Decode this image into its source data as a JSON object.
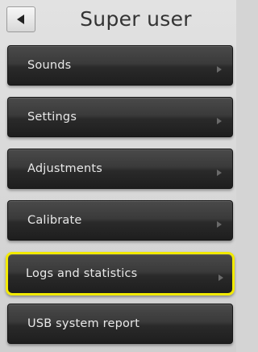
{
  "header": {
    "title": "Super user",
    "back_icon": "back-triangle-icon"
  },
  "menu": {
    "items": [
      {
        "label": "Sounds",
        "has_arrow": true
      },
      {
        "label": "Settings",
        "has_arrow": true
      },
      {
        "label": "Adjustments",
        "has_arrow": true
      },
      {
        "label": "Calibrate",
        "has_arrow": true
      },
      {
        "label": "Logs and statistics",
        "has_arrow": true,
        "highlighted": true
      },
      {
        "label": "USB system report",
        "has_arrow": false
      }
    ]
  },
  "colors": {
    "background": "#d4d4d4",
    "button_dark": "#2a2a2a",
    "button_text": "#e8e8e8",
    "highlight": "#f2ea00",
    "chevron": "#6a6a6a"
  }
}
